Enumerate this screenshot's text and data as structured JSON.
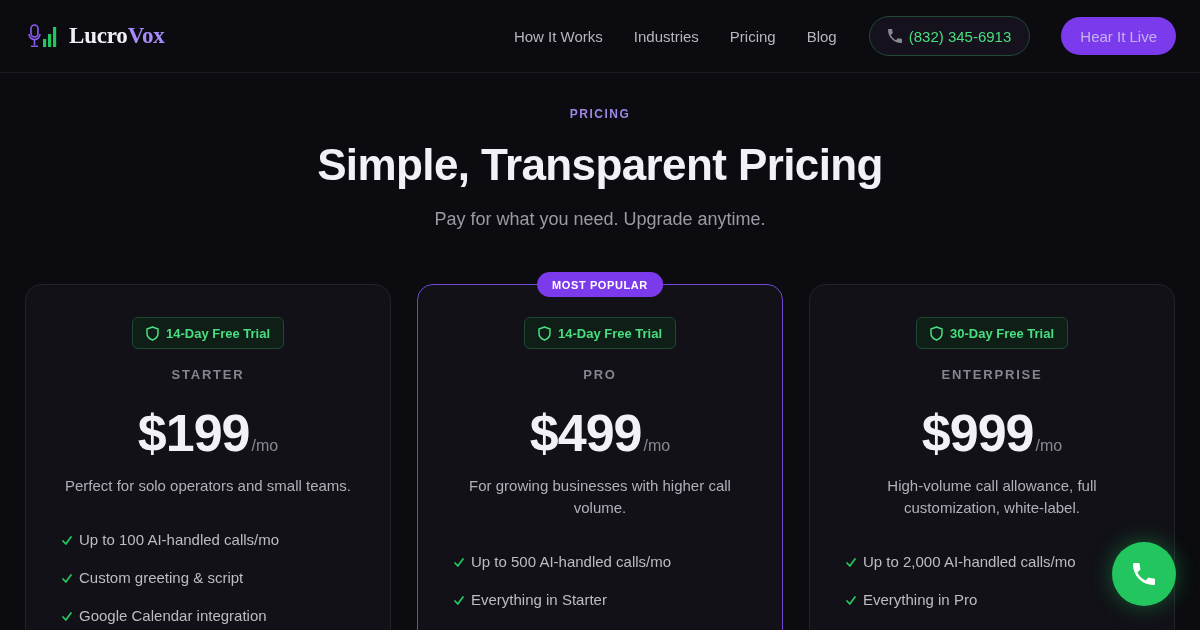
{
  "header": {
    "logo": {
      "name": "Lucro",
      "name_accent": "Vox"
    },
    "nav": [
      "How It Works",
      "Industries",
      "Pricing",
      "Blog"
    ],
    "phone_button": "(832) 345-6913",
    "cta_button": "Hear It Live"
  },
  "pricing": {
    "eyebrow": "PRICING",
    "title": "Simple, Transparent Pricing",
    "subtitle": "Pay for what you need. Upgrade anytime.",
    "plans": [
      {
        "featured": false,
        "trial": "14-Day Free Trial",
        "name": "STARTER",
        "price": "$199",
        "period": "/mo",
        "description": "Perfect for solo operators and small teams.",
        "features": [
          "Up to 100 AI-handled calls/mo",
          "Custom greeting & script",
          "Google Calendar integration"
        ]
      },
      {
        "featured": true,
        "badge": "MOST POPULAR",
        "trial": "14-Day Free Trial",
        "name": "PRO",
        "price": "$499",
        "period": "/mo",
        "description": "For growing businesses with higher call volume.",
        "features": [
          "Up to 500 AI-handled calls/mo",
          "Everything in Starter"
        ]
      },
      {
        "featured": false,
        "trial": "30-Day Free Trial",
        "name": "ENTERPRISE",
        "price": "$999",
        "period": "/mo",
        "description": "High-volume call allowance, full customization, white-label.",
        "features": [
          "Up to 2,000 AI-handled calls/mo",
          "Everything in Pro"
        ]
      }
    ]
  }
}
